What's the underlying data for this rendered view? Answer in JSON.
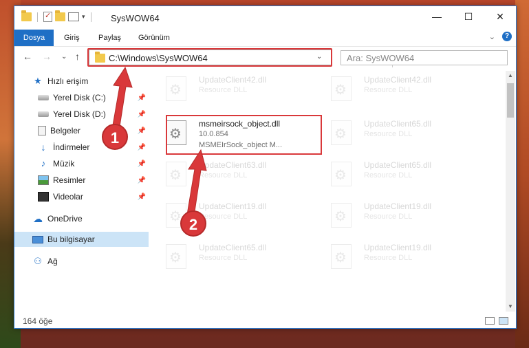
{
  "window": {
    "title": "SysWOW64",
    "controls": {
      "minimize": "—",
      "maximize": "☐",
      "close": "✕"
    }
  },
  "ribbon": {
    "tabs": [
      "Dosya",
      "Giriş",
      "Paylaş",
      "Görünüm"
    ],
    "help": "?"
  },
  "nav": {
    "address": "C:\\Windows\\SysWOW64",
    "search_placeholder": "Ara: SysWOW64",
    "back": "←",
    "forward": "→",
    "up": "↑",
    "refresh": "↻",
    "dropdown": "⌄",
    "recent": "⌄"
  },
  "sidebar": {
    "items": [
      {
        "label": "Hızlı erişim",
        "icon": "star-icon"
      },
      {
        "label": "Yerel Disk (C:)",
        "icon": "disk-icon",
        "pinned": true
      },
      {
        "label": "Yerel Disk (D:)",
        "icon": "disk-icon",
        "pinned": true
      },
      {
        "label": "Belgeler",
        "icon": "document-icon",
        "pinned": true
      },
      {
        "label": "İndirmeler",
        "icon": "download-icon",
        "pinned": true
      },
      {
        "label": "Müzik",
        "icon": "music-icon",
        "pinned": true
      },
      {
        "label": "Resimler",
        "icon": "pictures-icon",
        "pinned": true
      },
      {
        "label": "Videolar",
        "icon": "video-icon",
        "pinned": true
      },
      {
        "label": "OneDrive",
        "icon": "cloud-icon"
      },
      {
        "label": "Bu bilgisayar",
        "icon": "computer-icon",
        "selected": true
      },
      {
        "label": "Ağ",
        "icon": "network-icon"
      }
    ]
  },
  "files": {
    "highlighted": {
      "name": "msmeirsock_object.dll",
      "version": "10.0.854",
      "description": "MSMEIrSock_object M..."
    },
    "background": [
      {
        "name": "UpdateClient42.dll",
        "type": "Resource DLL"
      },
      {
        "name": "UpdateClient42.dll",
        "type": "Resource DLL"
      },
      {
        "name": "UpdateClient65.dll",
        "type": "Resource DLL"
      },
      {
        "name": "UpdateClient63.dll",
        "type": "Resource DLL"
      },
      {
        "name": "UpdateClient65.dll",
        "type": "Resource DLL"
      },
      {
        "name": "UpdateClient19.dll",
        "type": "Resource DLL"
      },
      {
        "name": "UpdateClient19.dll",
        "type": "Resource DLL"
      },
      {
        "name": "UpdateClient65.dll",
        "type": "Resource DLL"
      },
      {
        "name": "UpdateClient19.dll",
        "type": "Resource DLL"
      }
    ]
  },
  "status": {
    "item_count": "164 öğe"
  },
  "annotations": {
    "step1": "1",
    "step2": "2",
    "color": "#d9383a"
  }
}
